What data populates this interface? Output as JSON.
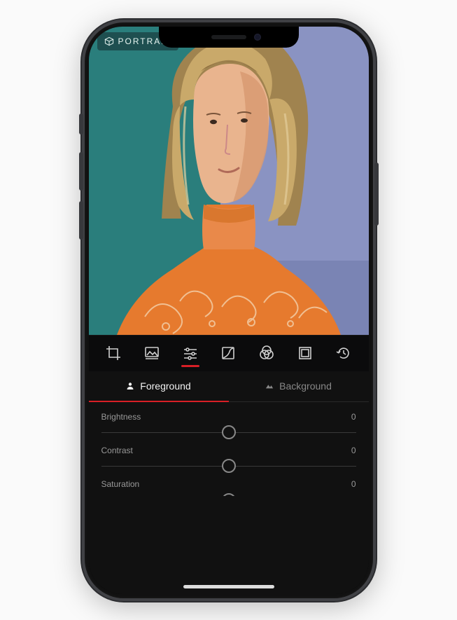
{
  "colors": {
    "accent": "#d81f26"
  },
  "mode_badge": {
    "label": "PORTRAIT",
    "icon": "cube-icon"
  },
  "toolbar_top": {
    "back_icon": "chevron-left",
    "favorite_icon": "heart-outline",
    "more_icon": "ellipsis",
    "share_icon": "share-up"
  },
  "edit_tools": {
    "active_index": 2,
    "items": [
      {
        "id": "crop",
        "icon": "crop-icon"
      },
      {
        "id": "presets",
        "icon": "picture-icon"
      },
      {
        "id": "adjust",
        "icon": "sliders-icon"
      },
      {
        "id": "curves",
        "icon": "curves-icon"
      },
      {
        "id": "filters",
        "icon": "venn-icon"
      },
      {
        "id": "frame",
        "icon": "frame-icon"
      },
      {
        "id": "history",
        "icon": "history-icon"
      }
    ]
  },
  "layer_tabs": {
    "active": "foreground",
    "foreground": {
      "label": "Foreground",
      "icon": "person-icon"
    },
    "background": {
      "label": "Background",
      "icon": "mountains-icon"
    }
  },
  "sliders": [
    {
      "id": "brightness",
      "label": "Brightness",
      "value": 0
    },
    {
      "id": "contrast",
      "label": "Contrast",
      "value": 0
    },
    {
      "id": "saturation",
      "label": "Saturation",
      "value": 0
    }
  ]
}
